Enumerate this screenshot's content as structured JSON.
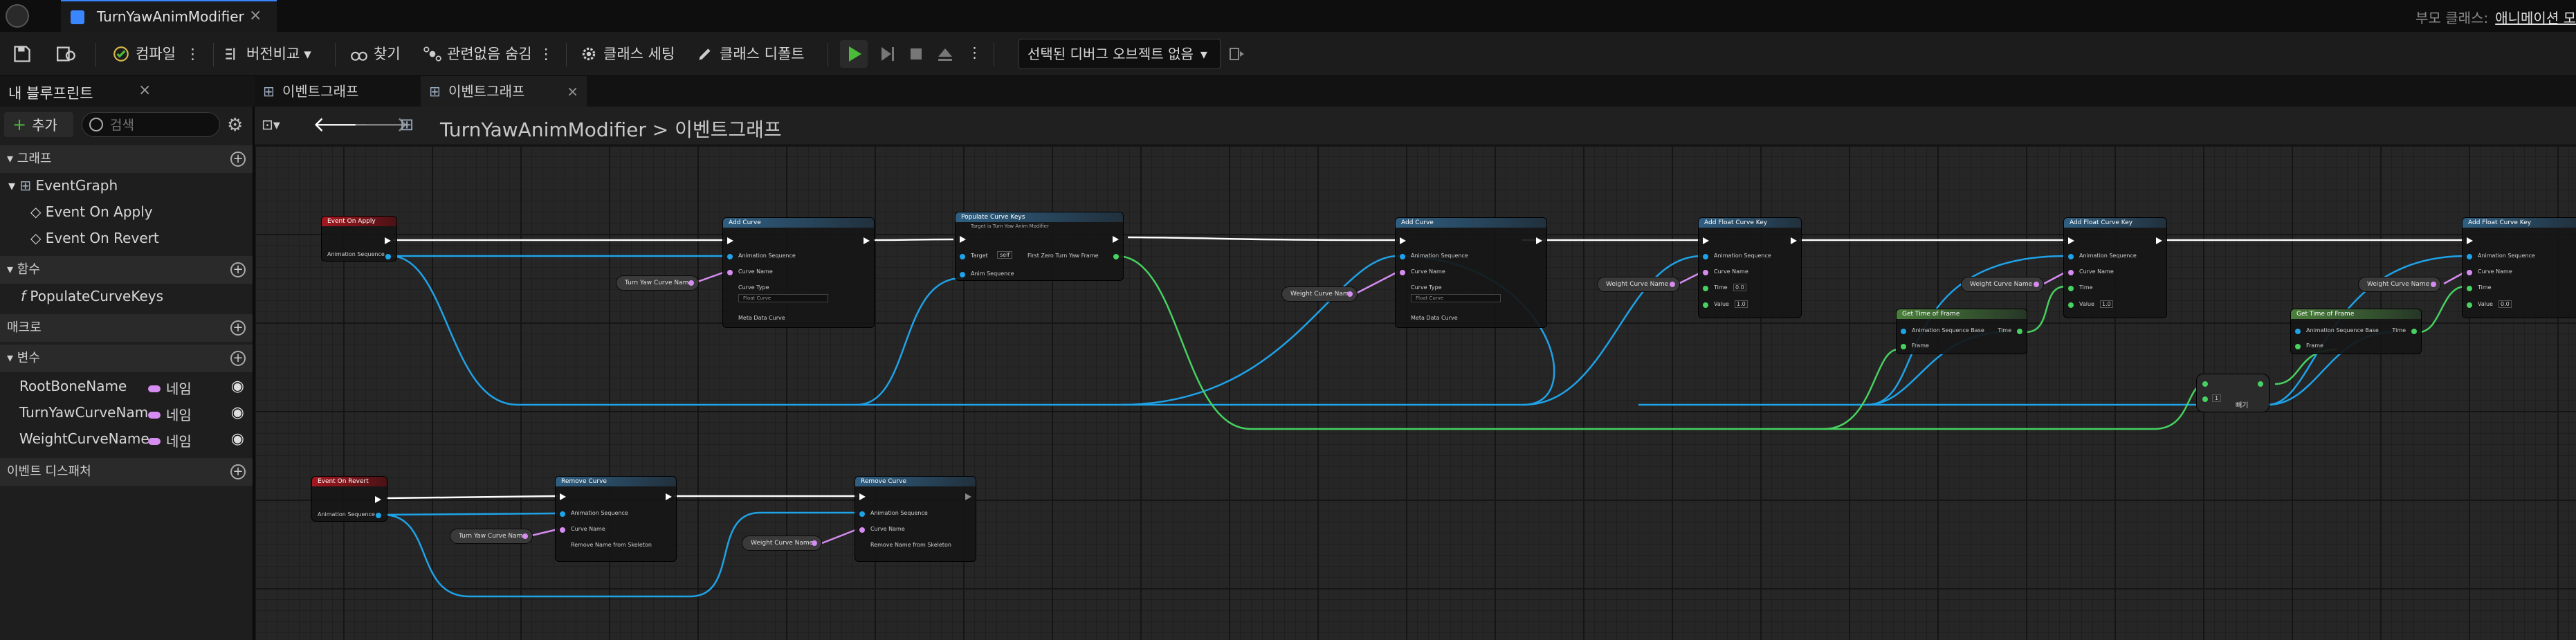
{
  "titlebar": {
    "tab_title": "TurnYawAnimModifier",
    "tab_close": "×",
    "parent_class_label": "부모 클래스:",
    "parent_class_link": "애니메이션 모"
  },
  "toolbar": {
    "compile_label": "컴파일",
    "diff_label": "버전비교",
    "find_label": "찾기",
    "hide_unrelated_label": "관련없음 숨김",
    "class_settings_label": "클래스 세팅",
    "class_defaults_label": "클래스 디폴트",
    "debug_object_label": "선택된 디버그 오브젝트 없음"
  },
  "left_panel": {
    "tab_label": "내 블루프린트",
    "tab_close": "×",
    "add_label": "추가",
    "search_placeholder": "검색",
    "sections": {
      "graphs": "그래프",
      "functions": "함수",
      "macros": "매크로",
      "variables": "변수",
      "event_dispatchers": "이벤트 디스패처"
    },
    "graph_items": [
      "EventGraph",
      "Event On Apply",
      "Event On Revert"
    ],
    "function_items": [
      "PopulateCurveKeys"
    ],
    "variables": [
      {
        "name": "RootBoneName",
        "type": "네임"
      },
      {
        "name": "TurnYawCurveName",
        "type": "네임"
      },
      {
        "name": "WeightCurveName",
        "type": "네임"
      }
    ]
  },
  "graph": {
    "tabs": [
      {
        "label": "이벤트그래프",
        "close": ""
      },
      {
        "label": "이벤트그래프",
        "close": "×"
      }
    ],
    "breadcrumb": "TurnYawAnimModifier > 이벤트그래프",
    "nodes": {
      "event_on_apply": "Event On Apply",
      "event_on_revert": "Event On Revert",
      "add_curve": "Add Curve",
      "populate_curve_keys": "Populate Curve Keys",
      "populate_sub": "Target is Turn Yaw Anim Modifier",
      "add_float_curve_key": "Add Float Curve Key",
      "get_time_of_frame": "Get Time of Frame",
      "remove_curve": "Remove Curve",
      "pin_animation_sequence": "Animation Sequence",
      "pin_animation_sequence_base": "Animation Sequence Base",
      "pin_curve_name": "Curve Name",
      "pin_curve_type": "Curve Type",
      "pin_meta_data_curve": "Meta Data Curve",
      "pin_target": "Target",
      "pin_self": "self",
      "pin_anim_sequence": "Anim Sequence",
      "pin_first_zero_turn_yaw_frame": "First Zero Turn Yaw Frame",
      "pin_time": "Time",
      "pin_value": "Value",
      "pin_frame": "Frame",
      "pin_remove_name_from_skeleton": "Remove Name from Skeleton",
      "curve_type_value": "Float Curve",
      "value_0": "0.0",
      "value_1": "1.0",
      "turn_yaw_curve_name": "Turn Yaw Curve Name",
      "weight_curve_name": "Weight Curve Name",
      "add_node_label": "빼기",
      "add_node_value": "1"
    }
  },
  "colors": {
    "exec": "#ffffff",
    "object_pin": "#1fa3e8",
    "name_pin": "#d68cf0",
    "float_pin": "#47d160",
    "accent": "#3a86ff"
  }
}
